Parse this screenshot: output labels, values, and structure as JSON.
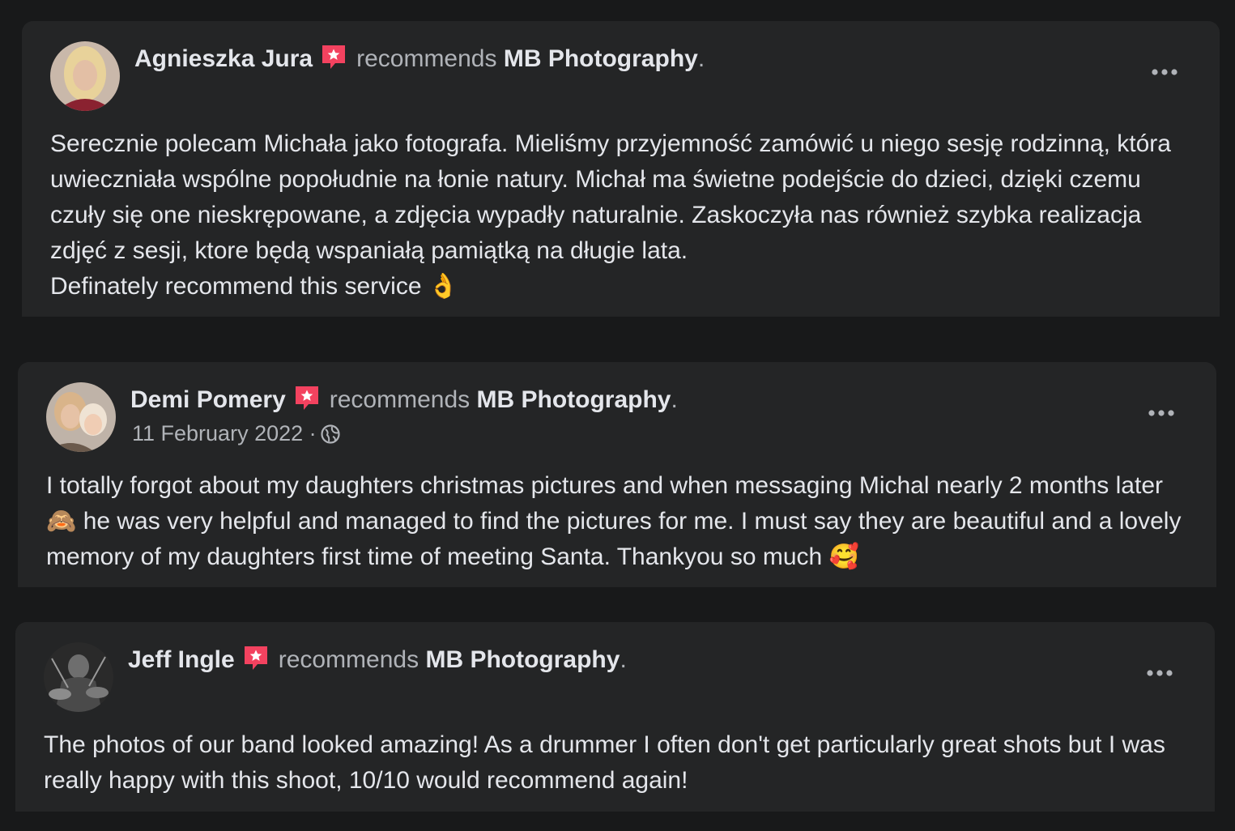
{
  "reviews": [
    {
      "author": "Agnieszka Jura",
      "verb": "recommends",
      "page": "MB Photography",
      "date": "",
      "body": "Serecznie polecam Michała jako fotografa. Mieliśmy przyjemność zamówić u niego sesję rodzinną, która uwieczniała wspólne popołudnie na łonie natury. Michał ma świetne podejście do dzieci, dzięki czemu czuły się one nieskrępowane, a zdjęcia wypadły naturalnie. Zaskoczyła nas również szybka realizacja zdjęć z sesji, ktore będą wspaniałą pamiątką na długie lata.\nDefinately recommend this service 👌"
    },
    {
      "author": "Demi Pomery",
      "verb": "recommends",
      "page": "MB Photography",
      "date": "11 February 2022",
      "body": "I totally forgot about my daughters christmas pictures and when messaging Michal nearly 2 months later 🙈 he was very helpful and managed to find the pictures for me. I must say they are beautiful and a lovely memory of my daughters first time of meeting Santa. Thankyou so much 🥰"
    },
    {
      "author": "Jeff Ingle",
      "verb": "recommends",
      "page": "MB Photography",
      "date": "",
      "body": "The photos of our band looked amazing! As a drummer I often don't get particularly great shots but I was really happy with this shoot, 10/10 would recommend again!"
    }
  ],
  "punctuation": {
    "period": ".",
    "separator": "·"
  },
  "icons": {
    "badge": "recommendation-badge-icon",
    "more": "more-options-icon",
    "privacy": "globe-icon"
  },
  "colors": {
    "background": "#18191a",
    "card": "#242526",
    "text_primary": "#e4e6eb",
    "text_secondary": "#b0b3b8",
    "badge": "#f3425f"
  }
}
